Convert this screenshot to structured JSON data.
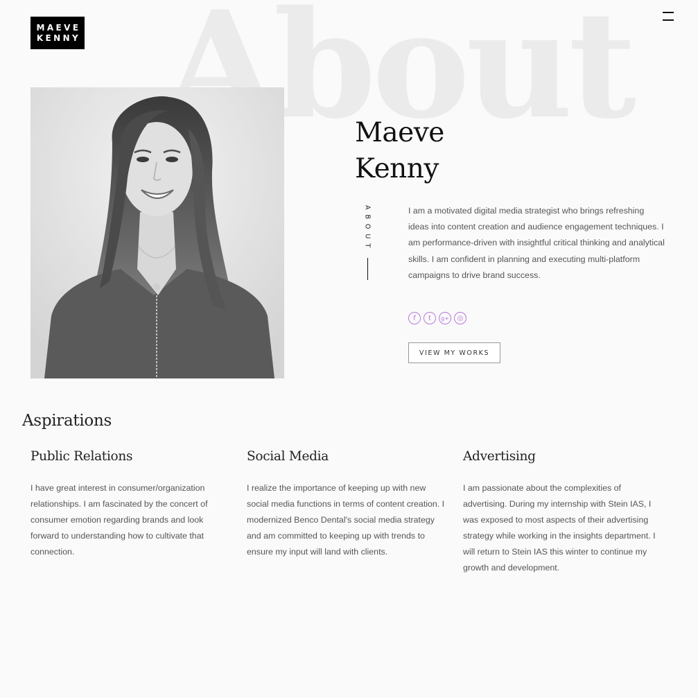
{
  "logo": {
    "line1": "MAEVE",
    "line2": "KENNY"
  },
  "header": {
    "menu_icon": "hamburger-icon"
  },
  "hero": {
    "background_word": "About",
    "name_line1": "Maeve",
    "name_line2": "Kenny",
    "vertical_label": "ABOUT",
    "bio": "I am a motivated digital media strategist who brings refreshing ideas into content creation and audience engagement techniques. I am performance-driven with insightful critical thinking and analytical skills. I am confident in planning and executing multi-platform campaigns to drive brand success.",
    "socials": [
      {
        "icon": "facebook-icon",
        "glyph": "f"
      },
      {
        "icon": "twitter-icon",
        "glyph": "t"
      },
      {
        "icon": "google-plus-icon",
        "glyph": "g+"
      },
      {
        "icon": "dribbble-icon",
        "glyph": "◎"
      }
    ],
    "social_color": "#b877d9",
    "cta_label": "VIEW MY WORKS"
  },
  "aspirations": {
    "title": "Aspirations",
    "items": [
      {
        "title": "Public Relations",
        "text": "I have great interest in consumer/organization relationships. I am fascinated by the concert of consumer emotion regarding brands and look forward to understanding how to cultivate that connection."
      },
      {
        "title": "Social Media",
        "text": "I realize the importance of keeping up with new social media functions in terms of content creation. I modernized Benco Dental's social media strategy and am committed to keeping up with trends to ensure my input will land with clients."
      },
      {
        "title": "Advertising",
        "text": "I am passionate about the complexities of advertising. During my internship with Stein IAS, I was exposed to most aspects of their advertising strategy while working in the insights department. I will return to Stein IAS this winter to continue my growth and development."
      }
    ]
  }
}
